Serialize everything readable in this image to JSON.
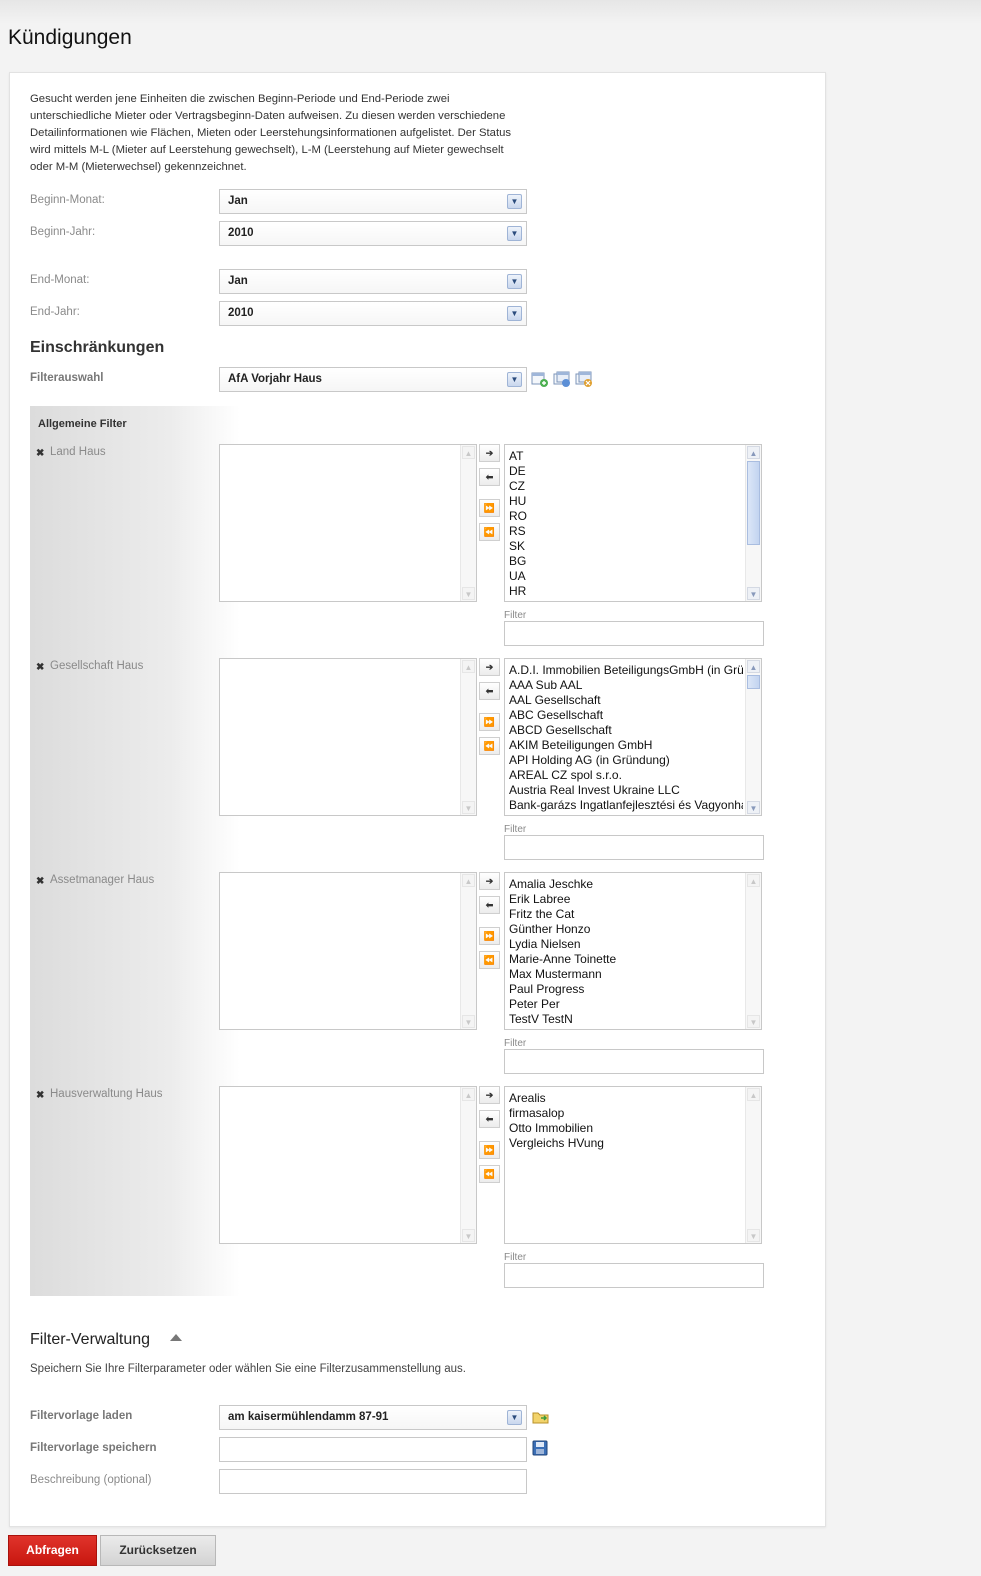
{
  "page": {
    "title": "Kündigungen"
  },
  "intro": "Gesucht werden jene Einheiten die zwischen Beginn-Periode und End-Periode zwei unterschiedliche Mieter oder Vertragsbeginn-Daten aufweisen. Zu diesen werden verschiedene Detailinformationen wie Flächen, Mieten oder Leerstehungsinformationen aufgelistet. Der Status wird mittels M-L (Mieter auf Leerstehung gewechselt), L-M (Leerstehung auf Mieter gewechselt oder M-M (Mieterwechsel) gekennzeichnet.",
  "period": {
    "begin_month_label": "Beginn-Monat:",
    "begin_month_value": "Jan",
    "begin_year_label": "Beginn-Jahr:",
    "begin_year_value": "2010",
    "end_month_label": "End-Monat:",
    "end_month_value": "Jan",
    "end_year_label": "End-Jahr:",
    "end_year_value": "2010"
  },
  "restrictions": {
    "title": "Einschränkungen",
    "filter_select_label": "Filterauswahl",
    "filter_select_value": "AfA Vorjahr Haus"
  },
  "general_filter": {
    "title": "Allgemeine Filter",
    "filter_caption": "Filter",
    "groups": [
      {
        "label": "Land Haus",
        "available": [
          "AT",
          "DE",
          "CZ",
          "HU",
          "RO",
          "RS",
          "SK",
          "BG",
          "UA",
          "HR"
        ]
      },
      {
        "label": "Gesellschaft Haus",
        "available": [
          "A.D.I. Immobilien BeteiligungsGmbH (in Gründung)",
          "AAA Sub AAL",
          "AAL Gesellschaft",
          "ABC Gesellschaft",
          "ABCD Gesellschaft",
          "AKIM Beteiligungen GmbH",
          "API Holding AG (in Gründung)",
          "AREAL CZ spol s.r.o.",
          "Austria Real Invest Ukraine LLC",
          "Bank-garázs Ingatlanfejlesztési és Vagyonhasznosító"
        ]
      },
      {
        "label": "Assetmanager Haus",
        "available": [
          "Amalia Jeschke",
          "Erik Labree",
          "Fritz the Cat",
          "Günther Honzo",
          "Lydia Nielsen",
          "Marie-Anne Toinette",
          "Max Mustermann",
          "Paul Progress",
          "Peter Per",
          "TestV TestN"
        ]
      },
      {
        "label": "Hausverwaltung Haus",
        "available": [
          "Arealis",
          "firmasalop",
          "Otto Immobilien",
          "Vergleichs HVung"
        ]
      }
    ]
  },
  "filter_management": {
    "title": "Filter-Verwaltung",
    "description": "Speichern Sie Ihre Filterparameter oder wählen Sie eine Filterzusammenstellung aus.",
    "load_label": "Filtervorlage laden",
    "load_value": "am kaisermühlendamm 87-91",
    "save_label": "Filtervorlage speichern",
    "save_value": "",
    "description_label": "Beschreibung (optional)",
    "description_value": ""
  },
  "actions": {
    "submit": "Abfragen",
    "reset": "Zurücksetzen"
  },
  "colors": {
    "primary_button": "#d21f18",
    "scroll_thumb": "#c3d4f0"
  }
}
